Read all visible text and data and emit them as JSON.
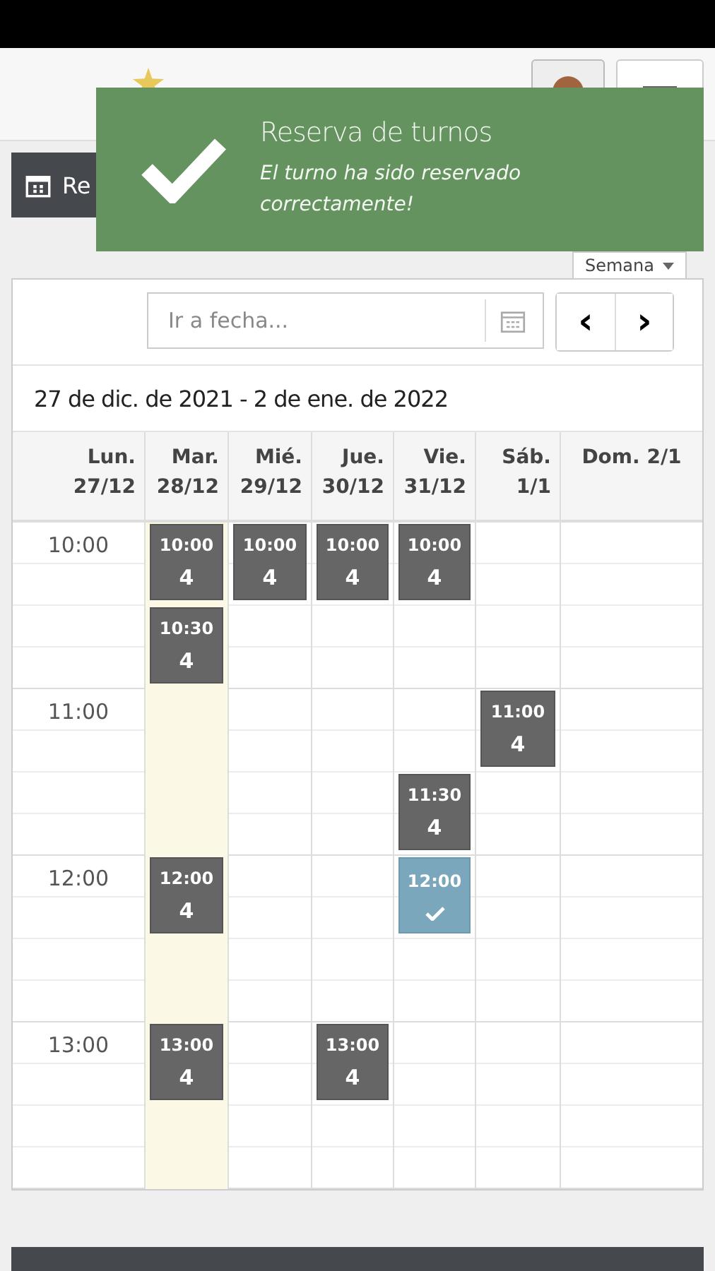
{
  "toast": {
    "title": "Reserva de turnos",
    "message": "El turno ha sido reservado correctamente!"
  },
  "view_button": {
    "label": "Re"
  },
  "view_select": {
    "value": "Semana"
  },
  "date_field": {
    "placeholder": "Ir a fecha..."
  },
  "nav": {
    "prev": "‹",
    "next": "›"
  },
  "range_title": "27 de dic. de 2021 - 2 de ene. de 2022",
  "columns": [
    {
      "day": "Lun.",
      "date": "27/12",
      "today": false
    },
    {
      "day": "Mar.",
      "date": "28/12",
      "today": true
    },
    {
      "day": "Mié.",
      "date": "29/12",
      "today": false
    },
    {
      "day": "Jue.",
      "date": "30/12",
      "today": false
    },
    {
      "day": "Vie.",
      "date": "31/12",
      "today": false
    },
    {
      "day": "Sáb.",
      "date": "1/1",
      "today": false
    },
    {
      "day": "Dom. 2/1",
      "today": false
    }
  ],
  "slots": [
    {
      "label": "10:00",
      "cells": [
        {
          "kind": "available",
          "time": "10:00",
          "count": "4"
        },
        {
          "kind": "available",
          "time": "10:00",
          "count": "4"
        },
        {
          "kind": "available",
          "time": "10:00",
          "count": "4"
        },
        {
          "kind": "available",
          "time": "10:00",
          "count": "4"
        },
        null,
        null
      ]
    },
    {
      "cells": [
        {
          "kind": "available",
          "time": "10:30",
          "count": "4"
        },
        null,
        null,
        null,
        null,
        null
      ]
    },
    {
      "label": "11:00",
      "cells": [
        null,
        null,
        null,
        null,
        {
          "kind": "available",
          "time": "11:00",
          "count": "4"
        },
        null
      ]
    },
    {
      "cells": [
        null,
        null,
        null,
        {
          "kind": "available",
          "time": "11:30",
          "count": "4"
        },
        null,
        null
      ]
    },
    {
      "label": "12:00",
      "cells": [
        {
          "kind": "available",
          "time": "12:00",
          "count": "4"
        },
        null,
        null,
        {
          "kind": "booked",
          "time": "12:00"
        },
        null,
        null
      ]
    },
    {
      "cells": [
        null,
        null,
        null,
        null,
        null,
        null
      ]
    },
    {
      "label": "13:00",
      "cells": [
        {
          "kind": "available",
          "time": "13:00",
          "count": "4"
        },
        null,
        {
          "kind": "available",
          "time": "13:00",
          "count": "4"
        },
        null,
        null,
        null
      ]
    },
    {
      "cells": [
        null,
        null,
        null,
        null,
        null,
        null
      ]
    }
  ]
}
